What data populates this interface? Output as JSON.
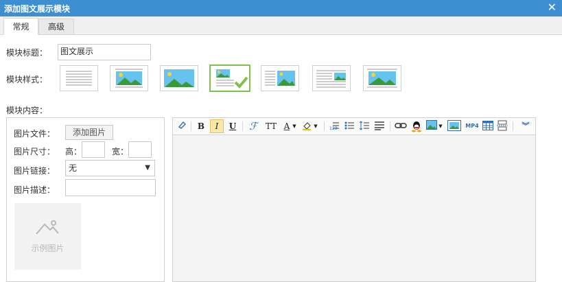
{
  "dialog": {
    "title": "添加图文展示模块",
    "close": "✕"
  },
  "tabs": [
    {
      "label": "常规"
    },
    {
      "label": "高级"
    }
  ],
  "form": {
    "module_title_label": "模块标题：",
    "module_title_value": "图文展示",
    "module_style_label": "模块样式：",
    "module_content_label": "模块内容：",
    "selected_style_index": 4
  },
  "image_panel": {
    "file_label": "图片文件：",
    "add_button": "添加图片",
    "size_label": "图片尺寸：",
    "height_label": "高：",
    "width_label": "宽：",
    "link_label": "图片链接：",
    "link_value": "无",
    "desc_label": "图片描述：",
    "sample_caption": "示例图片"
  },
  "toolbar": {
    "bold": "B",
    "italic": "I",
    "underline": "U",
    "font_size": "TT",
    "font_color": "A",
    "video": "MP4"
  },
  "colors": {
    "accent": "#3d8fd1",
    "selected": "#7cc24b"
  }
}
